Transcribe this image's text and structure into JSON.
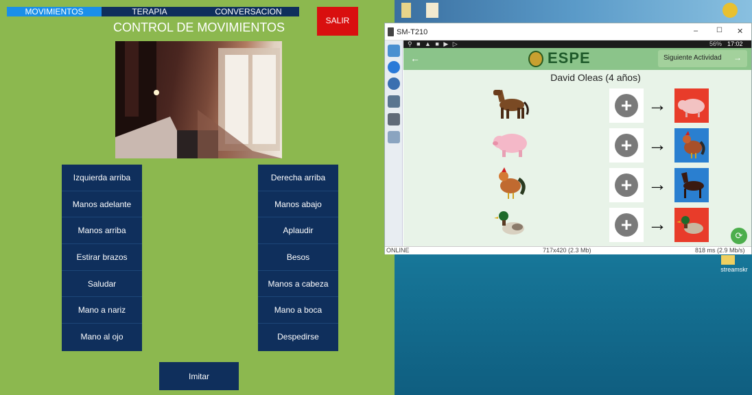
{
  "left_app": {
    "tabs": [
      "MOVIMIENTOS",
      "TERAPIA",
      "CONVERSACION"
    ],
    "salir_label": "SALIR",
    "title": "CONTROL DE MOVIMIENTOS",
    "left_buttons": [
      "Izquierda arriba",
      "Manos adelante",
      "Manos arriba",
      "Estirar brazos",
      "Saludar",
      "Mano a nariz",
      "Mano al ojo"
    ],
    "right_buttons": [
      "Derecha arriba",
      "Manos abajo",
      "Aplaudir",
      "Besos",
      "Manos a cabeza",
      "Mano a boca",
      "Despedirse"
    ],
    "imitar_label": "Imitar"
  },
  "tablet_window": {
    "title": "SM-T210",
    "controls": [
      "–",
      "☐",
      "✕"
    ],
    "android": {
      "status_time": "17:02",
      "status_battery": "56%",
      "logo_text": "ESPE",
      "back_icon": "←",
      "next_button": "Siguiente Actividad",
      "next_arrow": "→",
      "child_name": "David Oleas (4 años)",
      "rows": [
        {
          "animal": "horse-icon",
          "target": "pig-icon"
        },
        {
          "animal": "pig-icon",
          "target": "rooster-icon"
        },
        {
          "animal": "rooster-icon",
          "target": "horse-icon"
        },
        {
          "animal": "duck-icon",
          "target": "duck-icon"
        }
      ],
      "plus_symbol": "+",
      "arrow_symbol": "→",
      "fab_symbol": "⟳"
    },
    "footer": {
      "status": "ONLINE",
      "resolution": "717x420 (2.3 Mb)",
      "latency": "818 ms (2.9 Mb/s)"
    }
  },
  "desktop": {
    "icon_label": "streamskr"
  },
  "colors": {
    "panel_green": "#8cb84f",
    "button_navy": "#0f2f5c",
    "salir_red": "#d90f0f",
    "app_bar_green": "#8bc48a",
    "target_red": "#e83c2a",
    "target_blue": "#2a7fd0"
  }
}
